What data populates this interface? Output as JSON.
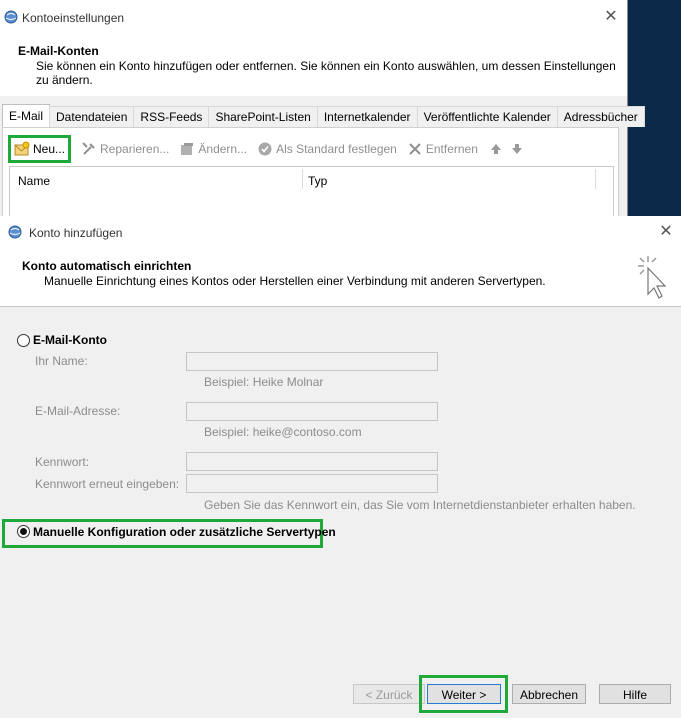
{
  "account_settings": {
    "title": "Kontoeinstellungen",
    "heading": "E-Mail-Konten",
    "description": "Sie können ein Konto hinzufügen oder entfernen. Sie können ein Konto auswählen, um dessen Einstellungen zu ändern.",
    "tabs": [
      {
        "label": "E-Mail"
      },
      {
        "label": "Datendateien"
      },
      {
        "label": "RSS-Feeds"
      },
      {
        "label": "SharePoint-Listen"
      },
      {
        "label": "Internetkalender"
      },
      {
        "label": "Veröffentlichte Kalender"
      },
      {
        "label": "Adressbücher"
      }
    ],
    "toolbar": {
      "new": "Neu...",
      "repair": "Reparieren...",
      "change": "Ändern...",
      "set_default": "Als Standard festlegen",
      "remove": "Entfernen"
    },
    "columns": {
      "name": "Name",
      "type": "Typ"
    }
  },
  "add_account": {
    "title": "Konto hinzufügen",
    "heading": "Konto automatisch einrichten",
    "subheading": "Manuelle Einrichtung eines Kontos oder Herstellen einer Verbindung mit anderen Servertypen.",
    "email_option": "E-Mail-Konto",
    "fields": {
      "name_label": "Ihr Name:",
      "name_hint": "Beispiel: Heike Molnar",
      "email_label": "E-Mail-Adresse:",
      "email_hint": "Beispiel: heike@contoso.com",
      "password_label": "Kennwort:",
      "password_repeat_label": "Kennwort erneut eingeben:",
      "password_hint": "Geben Sie das Kennwort ein, das Sie vom Internetdienstanbieter erhalten haben."
    },
    "manual_option": "Manuelle Konfiguration oder zusätzliche Servertypen",
    "buttons": {
      "back": "< Zurück",
      "next": "Weiter >",
      "cancel": "Abbrechen",
      "help": "Hilfe"
    }
  },
  "colors": {
    "highlight": "#1ea93a",
    "background": "#0b2a4a"
  }
}
